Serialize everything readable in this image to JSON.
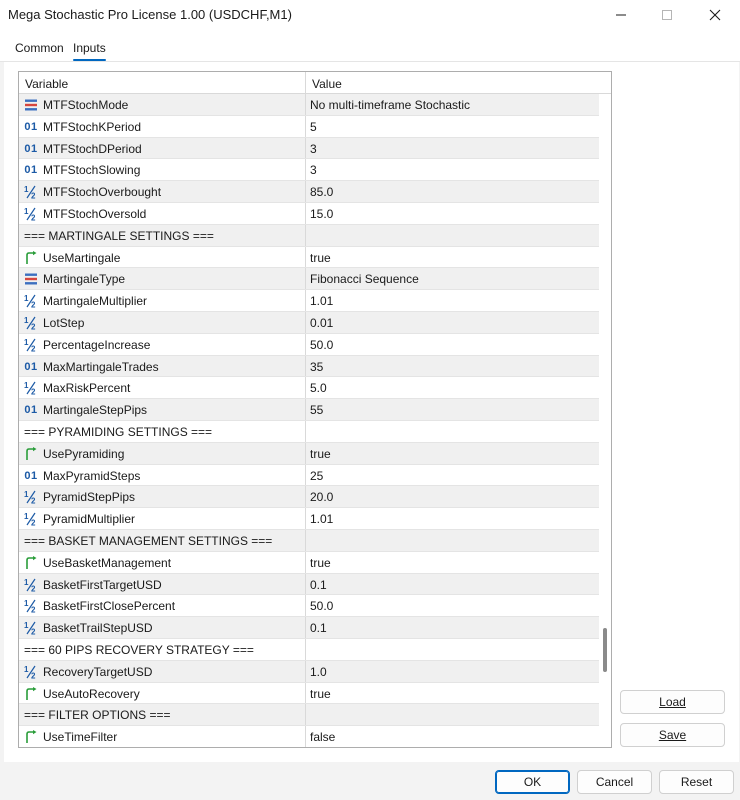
{
  "window": {
    "title": "Mega Stochastic Pro License 1.00 (USDCHF,M1)"
  },
  "tabs": [
    {
      "label": "Common"
    },
    {
      "label": "Inputs"
    }
  ],
  "table": {
    "headers": {
      "variable": "Variable",
      "value": "Value"
    },
    "rows": [
      {
        "icon": "enum-icon",
        "name": "MTFStochMode",
        "value": "No multi-timeframe Stochastic"
      },
      {
        "icon": "integer-icon",
        "name": "MTFStochKPeriod",
        "value": "5"
      },
      {
        "icon": "integer-icon",
        "name": "MTFStochDPeriod",
        "value": "3"
      },
      {
        "icon": "integer-icon",
        "name": "MTFStochSlowing",
        "value": "3"
      },
      {
        "icon": "double-icon",
        "name": "MTFStochOverbought",
        "value": "85.0"
      },
      {
        "icon": "double-icon",
        "name": "MTFStochOversold",
        "value": "15.0"
      },
      {
        "icon": "",
        "name": "=== MARTINGALE SETTINGS ===",
        "value": ""
      },
      {
        "icon": "bool-icon",
        "name": "UseMartingale",
        "value": "true"
      },
      {
        "icon": "enum-icon",
        "name": "MartingaleType",
        "value": "Fibonacci Sequence"
      },
      {
        "icon": "double-icon",
        "name": "MartingaleMultiplier",
        "value": "1.01"
      },
      {
        "icon": "double-icon",
        "name": "LotStep",
        "value": "0.01"
      },
      {
        "icon": "double-icon",
        "name": "PercentageIncrease",
        "value": "50.0"
      },
      {
        "icon": "integer-icon",
        "name": "MaxMartingaleTrades",
        "value": "35"
      },
      {
        "icon": "double-icon",
        "name": "MaxRiskPercent",
        "value": "5.0"
      },
      {
        "icon": "integer-icon",
        "name": "MartingaleStepPips",
        "value": "55"
      },
      {
        "icon": "",
        "name": "=== PYRAMIDING SETTINGS ===",
        "value": ""
      },
      {
        "icon": "bool-icon",
        "name": "UsePyramiding",
        "value": "true"
      },
      {
        "icon": "integer-icon",
        "name": "MaxPyramidSteps",
        "value": "25"
      },
      {
        "icon": "double-icon",
        "name": "PyramidStepPips",
        "value": "20.0"
      },
      {
        "icon": "double-icon",
        "name": "PyramidMultiplier",
        "value": "1.01"
      },
      {
        "icon": "",
        "name": "=== BASKET MANAGEMENT SETTINGS ===",
        "value": ""
      },
      {
        "icon": "bool-icon",
        "name": "UseBasketManagement",
        "value": "true"
      },
      {
        "icon": "double-icon",
        "name": "BasketFirstTargetUSD",
        "value": "0.1"
      },
      {
        "icon": "double-icon",
        "name": "BasketFirstClosePercent",
        "value": "50.0"
      },
      {
        "icon": "double-icon",
        "name": "BasketTrailStepUSD",
        "value": "0.1"
      },
      {
        "icon": "",
        "name": "=== 60 PIPS RECOVERY STRATEGY ===",
        "value": ""
      },
      {
        "icon": "double-icon",
        "name": "RecoveryTargetUSD",
        "value": "1.0"
      },
      {
        "icon": "bool-icon",
        "name": "UseAutoRecovery",
        "value": "true"
      },
      {
        "icon": "",
        "name": "=== FILTER OPTIONS ===",
        "value": ""
      },
      {
        "icon": "bool-icon",
        "name": "UseTimeFilter",
        "value": "false"
      }
    ]
  },
  "side_buttons": {
    "load": "Load",
    "save": "Save"
  },
  "footer_buttons": {
    "ok": "OK",
    "cancel": "Cancel",
    "reset": "Reset"
  },
  "icon_glyphs": {
    "integer": "01"
  },
  "colors": {
    "accent": "#0067c0",
    "int_icon": "#1c5aa6",
    "bool_icon": "#2a9d3a"
  }
}
